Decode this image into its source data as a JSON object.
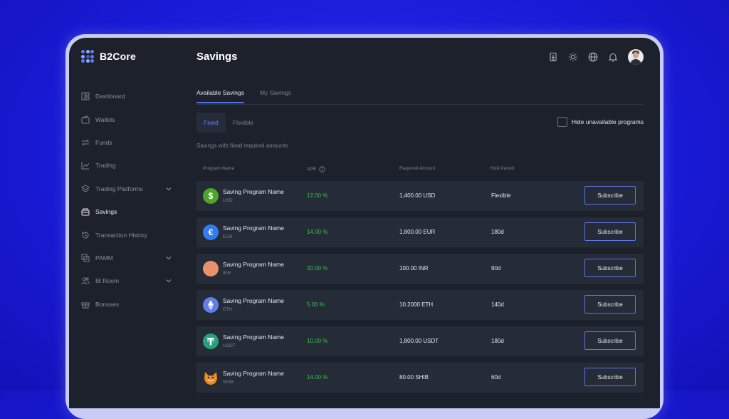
{
  "app": {
    "brand": "B2Core",
    "page_title": "Savings"
  },
  "sidebar": {
    "items": [
      {
        "label": "Dashboard",
        "icon": "dashboard-icon",
        "active": false,
        "expandable": false
      },
      {
        "label": "Wallets",
        "icon": "wallet-icon",
        "active": false,
        "expandable": false
      },
      {
        "label": "Funds",
        "icon": "transfer-arrows-icon",
        "active": false,
        "expandable": false
      },
      {
        "label": "Trading",
        "icon": "trend-chart-icon",
        "active": false,
        "expandable": false
      },
      {
        "label": "Trading Platforms",
        "icon": "layers-icon",
        "active": false,
        "expandable": true
      },
      {
        "label": "Savings",
        "icon": "piggy-box-icon",
        "active": true,
        "expandable": false
      },
      {
        "label": "Transaction History",
        "icon": "history-icon",
        "active": false,
        "expandable": false
      },
      {
        "label": "PAMM",
        "icon": "copy-window-icon",
        "active": false,
        "expandable": true
      },
      {
        "label": "IB Room",
        "icon": "users-icon",
        "active": false,
        "expandable": true
      },
      {
        "label": "Bonuses",
        "icon": "gift-icon",
        "active": false,
        "expandable": false
      }
    ]
  },
  "header": {
    "icons": [
      "document-download-icon",
      "sun-icon",
      "globe-icon",
      "bell-icon"
    ],
    "avatar": "user-avatar"
  },
  "tabs": [
    {
      "label": "Available Savings",
      "active": true
    },
    {
      "label": "My Savings",
      "active": false
    }
  ],
  "segment": [
    {
      "label": "Fixed",
      "active": true
    },
    {
      "label": "Flexible",
      "active": false
    }
  ],
  "hide_unavailable": {
    "label": "Hide unavailable programs",
    "checked": false
  },
  "subtitle": "Savings with fixed required amounts",
  "table": {
    "columns": [
      "Program Name",
      "APR",
      "Required Amount",
      "Hold Period"
    ],
    "rows": [
      {
        "name": "Saving Program Name",
        "currency": "USD",
        "apr": "12.00 %",
        "amount": "1,400.00 USD",
        "hold": "Flexible",
        "action": "Subscribe",
        "coin": "usd-coin-icon",
        "coin_color": "#4ea52a"
      },
      {
        "name": "Saving Program Name",
        "currency": "EUR",
        "apr": "14.00 %",
        "amount": "1,800.00 EUR",
        "hold": "180d",
        "action": "Subscribe",
        "coin": "euro-coin-icon",
        "coin_color": "#2f7cf6"
      },
      {
        "name": "Saving Program Name",
        "currency": "INR",
        "apr": "20.00 %",
        "amount": "100.00 INR",
        "hold": "90d",
        "action": "Subscribe",
        "coin": "inr-coin-icon",
        "coin_color": "#e8916a"
      },
      {
        "name": "Saving Program Name",
        "currency": "ETH",
        "apr": "5.00 %",
        "amount": "10.2000 ETH",
        "hold": "140d",
        "action": "Subscribe",
        "coin": "eth-coin-icon",
        "coin_color": "#627eea"
      },
      {
        "name": "Saving Program Name",
        "currency": "USDT",
        "apr": "10.00 %",
        "amount": "1,800.00 USDT",
        "hold": "180d",
        "action": "Subscribe",
        "coin": "tether-coin-icon",
        "coin_color": "#26a17b"
      },
      {
        "name": "Saving Program Name",
        "currency": "SHIB",
        "apr": "14.00 %",
        "amount": "80.00 SHIB",
        "hold": "60d",
        "action": "Subscribe",
        "coin": "shib-coin-icon",
        "coin_color": "#f28b1e"
      }
    ]
  },
  "colors": {
    "accent": "#4f72ea",
    "positive": "#35c24b",
    "background": "#1d212c",
    "row": "#262b38",
    "page_bg": "#1a1bd8"
  }
}
